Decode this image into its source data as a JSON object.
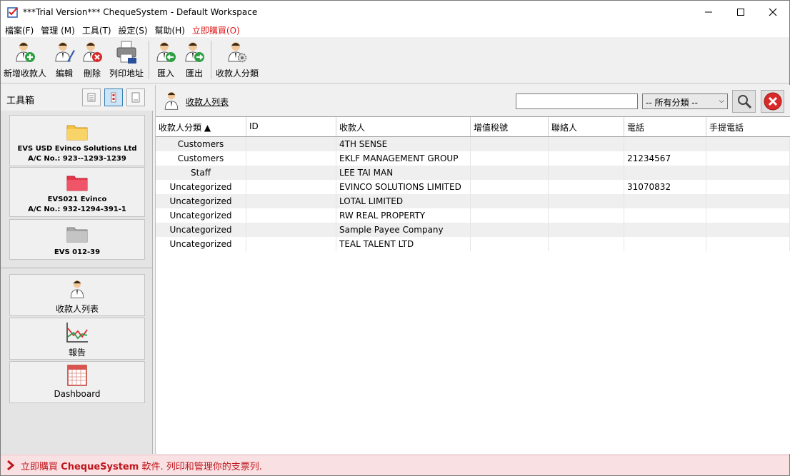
{
  "window": {
    "title": "***Trial Version*** ChequeSystem - Default Workspace"
  },
  "menu": {
    "items": [
      {
        "label": "檔案(F)"
      },
      {
        "label": "管理 (M)"
      },
      {
        "label": "工具(T)"
      },
      {
        "label": "設定(S)"
      },
      {
        "label": "幫助(H)"
      },
      {
        "label": "立即購買(O)"
      }
    ]
  },
  "toolbar": {
    "add_payee": "新增收款人",
    "edit": "編輯",
    "delete": "刪除",
    "print_address": "列印地址",
    "import": "匯入",
    "export": "匯出",
    "payee_category": "收款人分類"
  },
  "sidebar": {
    "title": "工具箱",
    "accounts": [
      {
        "name": "EVS USD Evinco Solutions Ltd",
        "acno": "A/C No.: 923--1293-1239",
        "color": "#f5c242"
      },
      {
        "name": "EVS021 Evinco",
        "acno": "A/C No.: 932-1294-391-1",
        "color": "#e8354a"
      },
      {
        "name": "EVS 012-39",
        "acno": "",
        "color": "#a8a8a8"
      }
    ],
    "nav": [
      {
        "label": "收款人列表"
      },
      {
        "label": "報告"
      },
      {
        "label": "Dashboard"
      }
    ]
  },
  "main": {
    "title": "收款人列表",
    "search_value": "",
    "category_filter": "-- 所有分類 --",
    "columns": [
      "收款人分類 ▲",
      "ID",
      "收款人",
      "增值稅號",
      "聯絡人",
      "電話",
      "手提電話"
    ],
    "rows": [
      {
        "category": "Customers",
        "id": "",
        "payee": "4TH SENSE",
        "vat": "",
        "contact": "",
        "phone": "",
        "mobile": ""
      },
      {
        "category": "Customers",
        "id": "",
        "payee": "EKLF MANAGEMENT GROUP",
        "vat": "",
        "contact": "",
        "phone": "21234567",
        "mobile": ""
      },
      {
        "category": "Staff",
        "id": "",
        "payee": "LEE TAI MAN",
        "vat": "",
        "contact": "",
        "phone": "",
        "mobile": ""
      },
      {
        "category": "Uncategorized",
        "id": "",
        "payee": "EVINCO SOLUTIONS LIMITED",
        "vat": "",
        "contact": "",
        "phone": "31070832",
        "mobile": ""
      },
      {
        "category": "Uncategorized",
        "id": "",
        "payee": "LOTAL  LIMITED",
        "vat": "",
        "contact": "",
        "phone": "",
        "mobile": ""
      },
      {
        "category": "Uncategorized",
        "id": "",
        "payee": "RW REAL PROPERTY",
        "vat": "",
        "contact": "",
        "phone": "",
        "mobile": ""
      },
      {
        "category": "Uncategorized",
        "id": "",
        "payee": "Sample Payee Company",
        "vat": "",
        "contact": "",
        "phone": "",
        "mobile": ""
      },
      {
        "category": "Uncategorized",
        "id": "",
        "payee": "TEAL TALENT LTD",
        "vat": "",
        "contact": "",
        "phone": "",
        "mobile": ""
      }
    ]
  },
  "status": {
    "prefix": "立即購買",
    "brand": "ChequeSystem",
    "suffix": "軟件. 列印和管理你的支票列."
  }
}
